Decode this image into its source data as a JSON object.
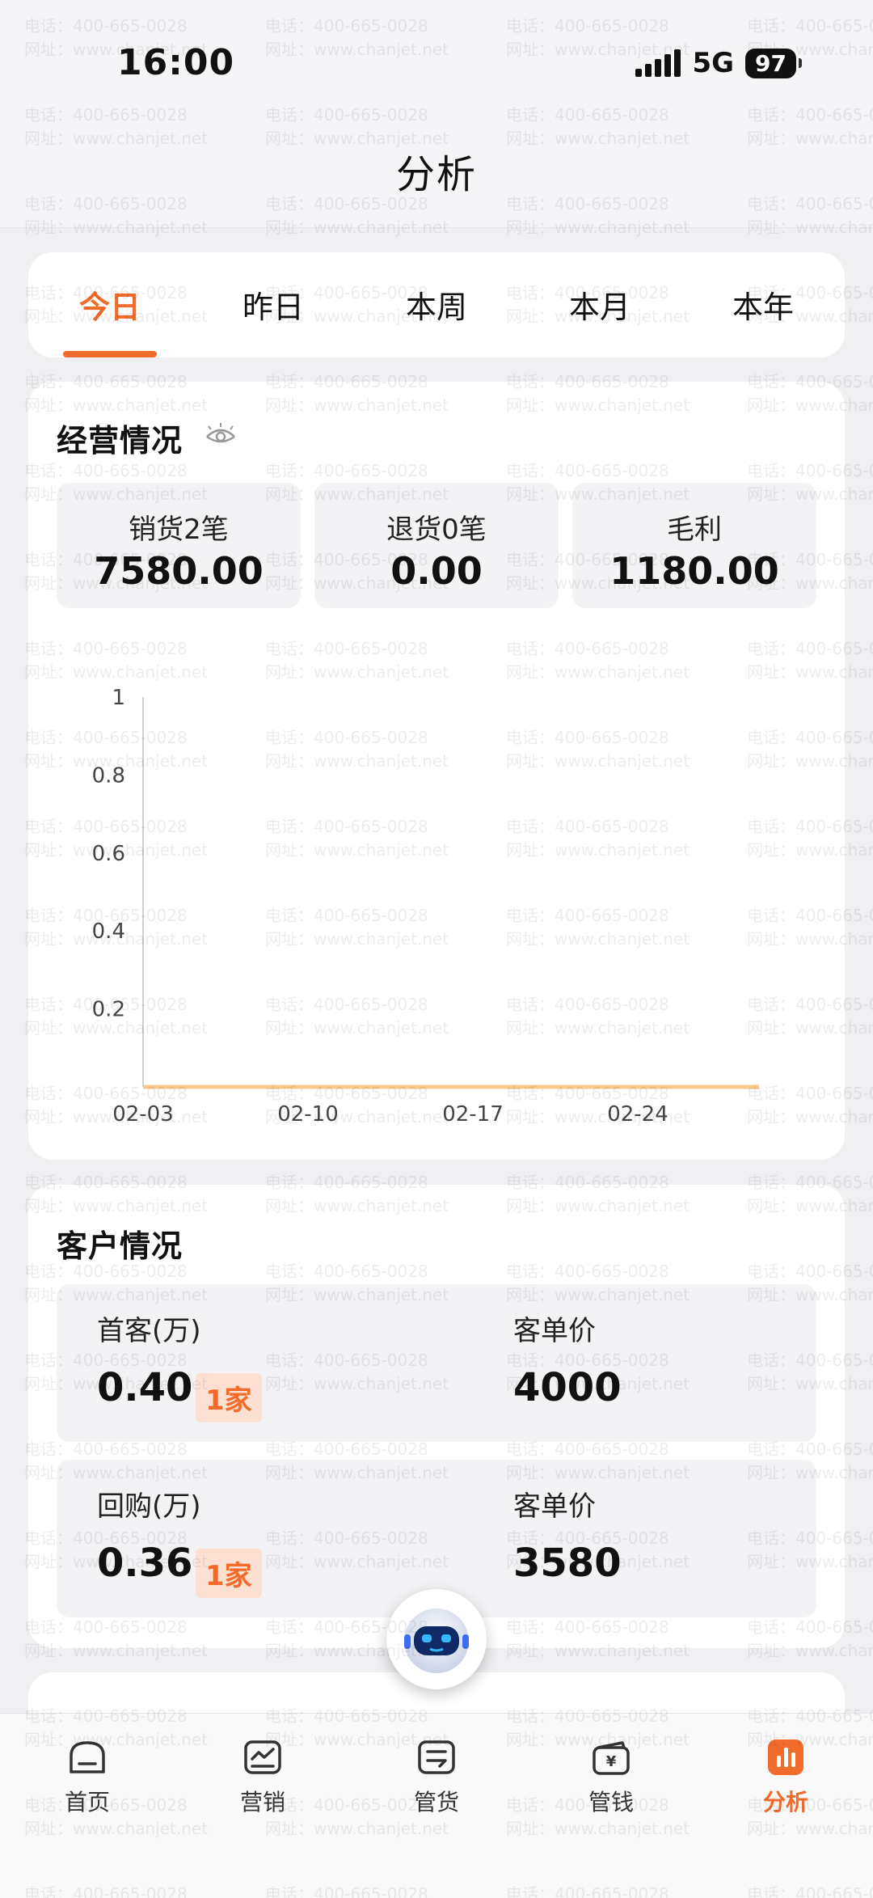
{
  "status": {
    "time": "16:00",
    "network": "5G",
    "battery": "97"
  },
  "header": {
    "title": "分析"
  },
  "period_tabs": [
    {
      "label": "今日",
      "active": true
    },
    {
      "label": "昨日",
      "active": false
    },
    {
      "label": "本周",
      "active": false
    },
    {
      "label": "本月",
      "active": false
    },
    {
      "label": "本年",
      "active": false
    }
  ],
  "business": {
    "title": "经营情况",
    "stats": [
      {
        "label": "销货2笔",
        "value": "7580.00"
      },
      {
        "label": "退货0笔",
        "value": "0.00"
      },
      {
        "label": "毛利",
        "value": "1180.00"
      }
    ]
  },
  "chart_data": {
    "type": "line",
    "x": [
      "02-03",
      "02-10",
      "02-17",
      "02-24"
    ],
    "xticks": [
      "02-03",
      "02-10",
      "02-17",
      "02-24"
    ],
    "yticks": [
      "0.2",
      "0.4",
      "0.6",
      "0.8",
      "1"
    ],
    "ylim": [
      0,
      1
    ],
    "series": [
      {
        "values": [
          0,
          0,
          0,
          0
        ],
        "color": "#f7c98b"
      }
    ],
    "grid": false
  },
  "customers": {
    "title": "客户情况",
    "rows": [
      {
        "label": "首客(万)",
        "value": "0.40",
        "badge": "1家",
        "price_label": "客单价",
        "price": "4000"
      },
      {
        "label": "回购(万)",
        "value": "0.36",
        "badge": "1家",
        "price_label": "客单价",
        "price": "3580"
      }
    ]
  },
  "next_section": {
    "partial_title": ""
  },
  "tabbar": [
    {
      "label": "首页",
      "icon": "home-icon",
      "active": false
    },
    {
      "label": "营销",
      "icon": "marketing-icon",
      "active": false
    },
    {
      "label": "管货",
      "icon": "goods-icon",
      "active": false
    },
    {
      "label": "管钱",
      "icon": "money-icon",
      "active": false
    },
    {
      "label": "分析",
      "icon": "analysis-icon",
      "active": true
    }
  ],
  "watermark": {
    "phone": "电话：400-665-0028",
    "site": "网址：www.chanjet.net"
  },
  "colors": {
    "accent": "#f26b2a",
    "badge_bg": "#fde0d2",
    "line": "#f7c98b"
  }
}
